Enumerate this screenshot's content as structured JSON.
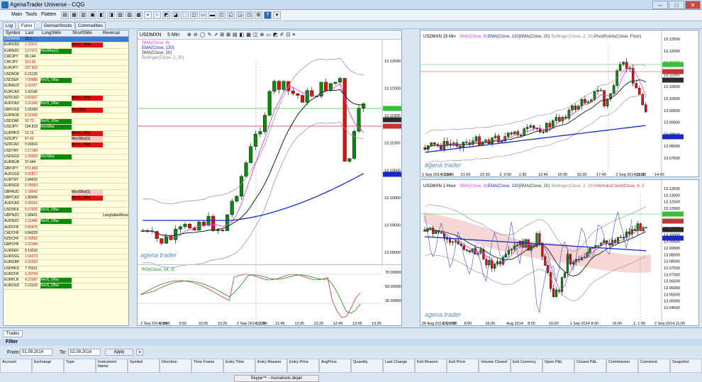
{
  "window": {
    "title": "AgenaTrader Universe - CQG"
  },
  "menu": [
    "Main",
    "Tools",
    "Flatten"
  ],
  "tabs": [
    "Log",
    "Forex",
    "GermanStocks",
    "Commodities"
  ],
  "grid": {
    "headers": [
      "Symbol",
      "Last",
      "LongSMin",
      "ShortSMin",
      "Reversal"
    ],
    "rows": [
      {
        "sym": "USDMXN",
        "last": "13.1...",
        "c1": "",
        "c2": "",
        "c3": ""
      },
      {
        "sym": "EURUSD",
        "last": "1.31151",
        "c1": "",
        "c2": "MovS_VBar",
        "c3": ""
      },
      {
        "sym": "EURNZD",
        "last": "1.57071",
        "c1": "RevSBar[1]",
        "c2": "",
        "c3": ""
      },
      {
        "sym": "CADJPY",
        "last": "96.144",
        "c1": "",
        "c2": "",
        "c3": ""
      },
      {
        "sym": "CHFJPY",
        "last": "113.99",
        "c1": "",
        "c2": "",
        "c3": ""
      },
      {
        "sym": "EURJPY",
        "last": "137.602",
        "c1": "",
        "c2": "",
        "c3": ""
      },
      {
        "sym": "USDNOK",
        "last": "6.15125",
        "c1": "",
        "c2": "",
        "c3": ""
      },
      {
        "sym": "USDSEK",
        "last": "7.00885",
        "c1": "RevS_VBar",
        "c2": "",
        "c3": ""
      },
      {
        "sym": "EURAUD",
        "last": "1.41187",
        "c1": "",
        "c2": "",
        "c3": ""
      },
      {
        "sym": "EURCAD",
        "last": "1.43106",
        "c1": "",
        "c2": "",
        "c3": ""
      },
      {
        "sym": "NZDUSD",
        "last": "0.83327",
        "c1": "",
        "c2": "MovS_VBar",
        "c3": ""
      },
      {
        "sym": "AUDCAD",
        "last": "1.01343",
        "c1": "RevS_VBar",
        "c2": "",
        "c3": ""
      },
      {
        "sym": "GBPUSD",
        "last": "1.65369",
        "c1": "",
        "c2": "MovSBar",
        "c3": ""
      },
      {
        "sym": "EURNOK",
        "last": "8.11999",
        "c1": "",
        "c2": "",
        "c3": ""
      },
      {
        "sym": "USDZAR",
        "last": "10.72...",
        "c1": "RevS_VBar",
        "c2": "",
        "c3": ""
      },
      {
        "sym": "USDJPY",
        "last": "104.818",
        "c1": "RevSBar",
        "c2": "",
        "c3": ""
      },
      {
        "sym": "EURHKD",
        "last": "10.16...",
        "c1": "",
        "c2": "MovS_VBar",
        "c3": ""
      },
      {
        "sym": "NZDJPY",
        "last": "87.42",
        "c1": "",
        "c2": "MovSBar[1]",
        "c3": ""
      },
      {
        "sym": "NZDCAD",
        "last": "0.90916",
        "c1": "",
        "c2": "MovS_VBar",
        "c3": ""
      },
      {
        "sym": "USDTRY",
        "last": "2.17199",
        "c1": "",
        "c2": "",
        "c3": ""
      },
      {
        "sym": "USDSGD",
        "last": "1.25003",
        "c1": "RevSBar",
        "c2": "",
        "c3": ""
      },
      {
        "sym": "EURRUB",
        "last": "37.444",
        "c1": "",
        "c2": "",
        "c3": ""
      },
      {
        "sym": "GBPJPY",
        "last": "173.499",
        "c1": "",
        "c2": "",
        "c3": ""
      },
      {
        "sym": "AUDUSD",
        "last": "0.92877",
        "c1": "",
        "c2": "",
        "c3": ""
      },
      {
        "sym": "EURTRY",
        "last": "2.84915",
        "c1": "",
        "c2": "",
        "c3": ""
      },
      {
        "sym": "EURSGD",
        "last": "0.78003",
        "c1": "",
        "c2": "",
        "c3": ""
      },
      {
        "sym": "GBPAUD",
        "last": "1.78042",
        "c1": "",
        "c2": "MovSBar[1]",
        "c3": ""
      },
      {
        "sym": "GBPCAD",
        "last": "1.80436",
        "c1": "",
        "c2": "MovS_VBar",
        "c3": ""
      },
      {
        "sym": "AUDCAD",
        "last": "1.09113",
        "c1": "",
        "c2": "",
        "c3": ""
      },
      {
        "sym": "USDDKK",
        "last": "5.67926",
        "c1": "RevS_VBar",
        "c2": "",
        "c3": ""
      },
      {
        "sym": "GBPNZD",
        "last": "1.98421",
        "c1": "",
        "c2": "",
        "c3": "LongSabe/Reve..."
      },
      {
        "sym": "AUDNZD",
        "last": "1.11446",
        "c1": "RevS_VBar",
        "c2": "",
        "c3": ""
      },
      {
        "sym": "AUDCHF",
        "last": "0.85475",
        "c1": "",
        "c2": "",
        "c3": ""
      },
      {
        "sym": "CADCHF",
        "last": "0.84329",
        "c1": "",
        "c2": "",
        "c3": ""
      },
      {
        "sym": "NZDCHF",
        "last": "0.76552",
        "c1": "",
        "c2": "",
        "c3": ""
      },
      {
        "sym": "GBPCHF",
        "last": "1.52184",
        "c1": "",
        "c2": "",
        "c3": ""
      },
      {
        "sym": "EURSEK",
        "last": "9.19216",
        "c1": "",
        "c2": "",
        "c3": ""
      },
      {
        "sym": "EURSSG",
        "last": "1.64373",
        "c1": "",
        "c2": "",
        "c3": ""
      },
      {
        "sym": "EURGBP",
        "last": "0.92003",
        "c1": "",
        "c2": "",
        "c3": ""
      },
      {
        "sym": "USDHKD",
        "last": "7.75011",
        "c1": "",
        "c2": "",
        "c3": ""
      },
      {
        "sym": "EURCHF",
        "last": "1.20704",
        "c1": "",
        "c2": "",
        "c3": ""
      },
      {
        "sym": "EURPLN",
        "last": "4.21097",
        "c1": "RevS_VBar",
        "c2": "",
        "c3": ""
      },
      {
        "sym": "EURUSD",
        "last": "2.21103",
        "c1": "RevS_VBar",
        "c2": "",
        "c3": ""
      }
    ]
  },
  "chart1": {
    "symbol": "USDMXN",
    "interval": "5 Min",
    "legend": [
      "SMA(Close, 8)",
      "EMA(Close, 130)",
      "SMA(Close, 20)",
      "Bollinger(Close, 2, 20)"
    ],
    "yticks": [
      "13.12500",
      "13.12000",
      "13.11500",
      "13.11000",
      "13.10500",
      "13.10000",
      "13.09500",
      "13.09000"
    ],
    "xticks": [
      "2 Sep 2014, 8:45",
      "9:35",
      "9:55",
      "10:05",
      "10:25",
      "2 Sep 2014,11:00",
      "11:25",
      "11:45",
      "12:05",
      "12:25",
      "12:45",
      "13:05",
      "13:25"
    ],
    "rsi_label": "RSI(Close, 14, 3)",
    "rsi_ticks": [
      "70.00000",
      "50.00000",
      "30.00000"
    ],
    "brand": "agena trader"
  },
  "chart2": {
    "title": "USDMXN 15 Min",
    "legend": [
      "SMA(Close, 8)",
      "EMA(Close, 130)",
      "SMA(Close, 20)",
      "Bollinger(Close, 2, 20)",
      "PivotPoints(Close, Floor)"
    ],
    "xticks": [
      "1 Sep 2014, 15:45",
      "19:30",
      "21:00",
      "22:30",
      "2, 0:00",
      "1:30",
      "12:45",
      "15:00",
      "16:30",
      "17:45",
      "2 Sep 2014,11:00",
      "13:15",
      "14:45"
    ],
    "brand": "agena trader"
  },
  "chart3": {
    "title": "USDMXN 1 Hour",
    "legend": [
      "SMA(Close, 8)",
      "EMA(Close, 130)",
      "SMA(Close, 20)",
      "Bollinger(Close, 2, 20)",
      "IchimokuCloud(Close, 9, 2"
    ],
    "xticks": [
      "28 Aug 2014, 16:00",
      "29, 0:00",
      "8:00",
      "16:00",
      "Aug 2014",
      "8:00",
      "16:00",
      "1 Sep 2014",
      "8:00",
      "16:00",
      "2, 1:00",
      "2 Sep 2014,11:00"
    ],
    "brand": "agena trader"
  },
  "bottom": {
    "tab": "Trades",
    "filter_label": "Filter",
    "from_label": "From:",
    "from_value": "01.09.2014",
    "to_label": "To:",
    "to_value": "02.09.2014",
    "apply": "Apply",
    "columns": [
      "Account",
      "Exchange",
      "Type",
      "Instrument Name",
      "Symbol",
      "Direction",
      "Time Frame",
      "Entry Time",
      "Entry Reason",
      "Entry Price",
      "AvgPrice",
      "Quantity",
      "Last Change",
      "Exit Reason",
      "Exit Price",
      "Volume Closed",
      "Exit Currency",
      "Open P&L",
      "Closed P&L",
      "Commission",
      "Comment",
      "Snapshot"
    ],
    "skype": "Skype™ - murselovic.dejan"
  },
  "colors": {
    "up": "#0a8a0a",
    "down": "#e01010",
    "sma8": "#e040e0",
    "ema130": "#1a28c8",
    "sma20": "#1a3a1a"
  }
}
